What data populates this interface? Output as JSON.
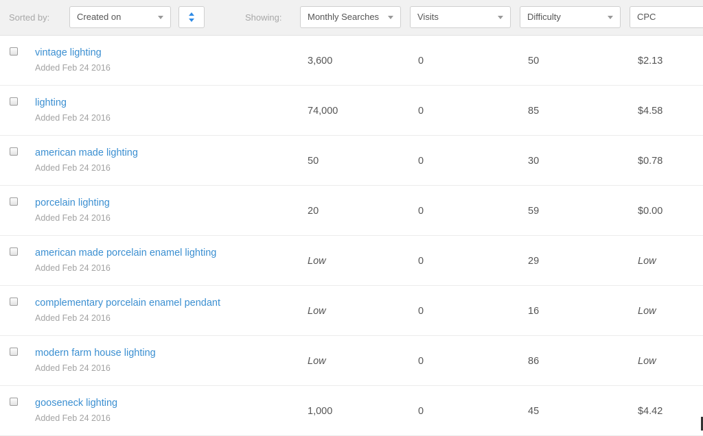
{
  "toolbar": {
    "sorted_by_label": "Sorted by:",
    "sort_select_value": "Created on",
    "showing_label": "Showing:",
    "columns": [
      "Monthly Searches",
      "Visits",
      "Difficulty",
      "CPC"
    ]
  },
  "colors": {
    "link": "#3b8fd1",
    "toggle_accent": "#2f8be6"
  },
  "rows": [
    {
      "keyword": "vintage lighting",
      "added": "Added Feb 24 2016",
      "monthly_searches": "3,600",
      "visits": "0",
      "difficulty": "50",
      "cpc": "$2.13"
    },
    {
      "keyword": "lighting",
      "added": "Added Feb 24 2016",
      "monthly_searches": "74,000",
      "visits": "0",
      "difficulty": "85",
      "cpc": "$4.58"
    },
    {
      "keyword": "american made lighting",
      "added": "Added Feb 24 2016",
      "monthly_searches": "50",
      "visits": "0",
      "difficulty": "30",
      "cpc": "$0.78"
    },
    {
      "keyword": "porcelain lighting",
      "added": "Added Feb 24 2016",
      "monthly_searches": "20",
      "visits": "0",
      "difficulty": "59",
      "cpc": "$0.00"
    },
    {
      "keyword": "american made porcelain enamel lighting",
      "added": "Added Feb 24 2016",
      "monthly_searches": "Low",
      "visits": "0",
      "difficulty": "29",
      "cpc": "Low"
    },
    {
      "keyword": "complementary porcelain enamel pendant",
      "added": "Added Feb 24 2016",
      "monthly_searches": "Low",
      "visits": "0",
      "difficulty": "16",
      "cpc": "Low"
    },
    {
      "keyword": "modern farm house lighting",
      "added": "Added Feb 24 2016",
      "monthly_searches": "Low",
      "visits": "0",
      "difficulty": "86",
      "cpc": "Low"
    },
    {
      "keyword": "gooseneck lighting",
      "added": "Added Feb 24 2016",
      "monthly_searches": "1,000",
      "visits": "0",
      "difficulty": "45",
      "cpc": "$4.42"
    }
  ]
}
